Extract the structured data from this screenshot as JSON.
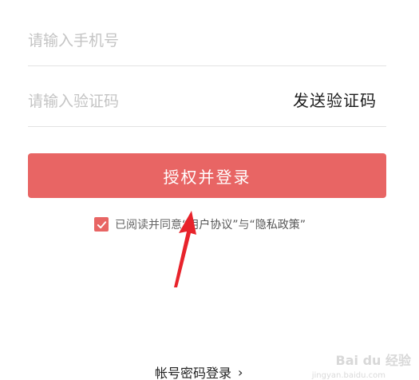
{
  "form": {
    "phone": {
      "placeholder": "请输入手机号",
      "value": ""
    },
    "code": {
      "placeholder": "请输入验证码",
      "value": ""
    },
    "send_code_label": "发送验证码"
  },
  "login_button": {
    "label": "授权并登录"
  },
  "agreement": {
    "checked": true,
    "prefix": "已阅读并同意",
    "user_agreement": "“用户协议”",
    "connector": "与",
    "privacy_policy": "“隐私政策”"
  },
  "account_login": {
    "label": "帐号密码登录",
    "chevron": "›"
  },
  "watermark": {
    "text": "Bai du 经验",
    "sub": "jingyan.baidu.com"
  },
  "colors": {
    "accent": "#e86564",
    "arrow": "#e8232b"
  },
  "icons": {
    "checkbox": "check-icon",
    "chevron": "chevron-right-icon",
    "annotation": "arrow-up-icon"
  }
}
